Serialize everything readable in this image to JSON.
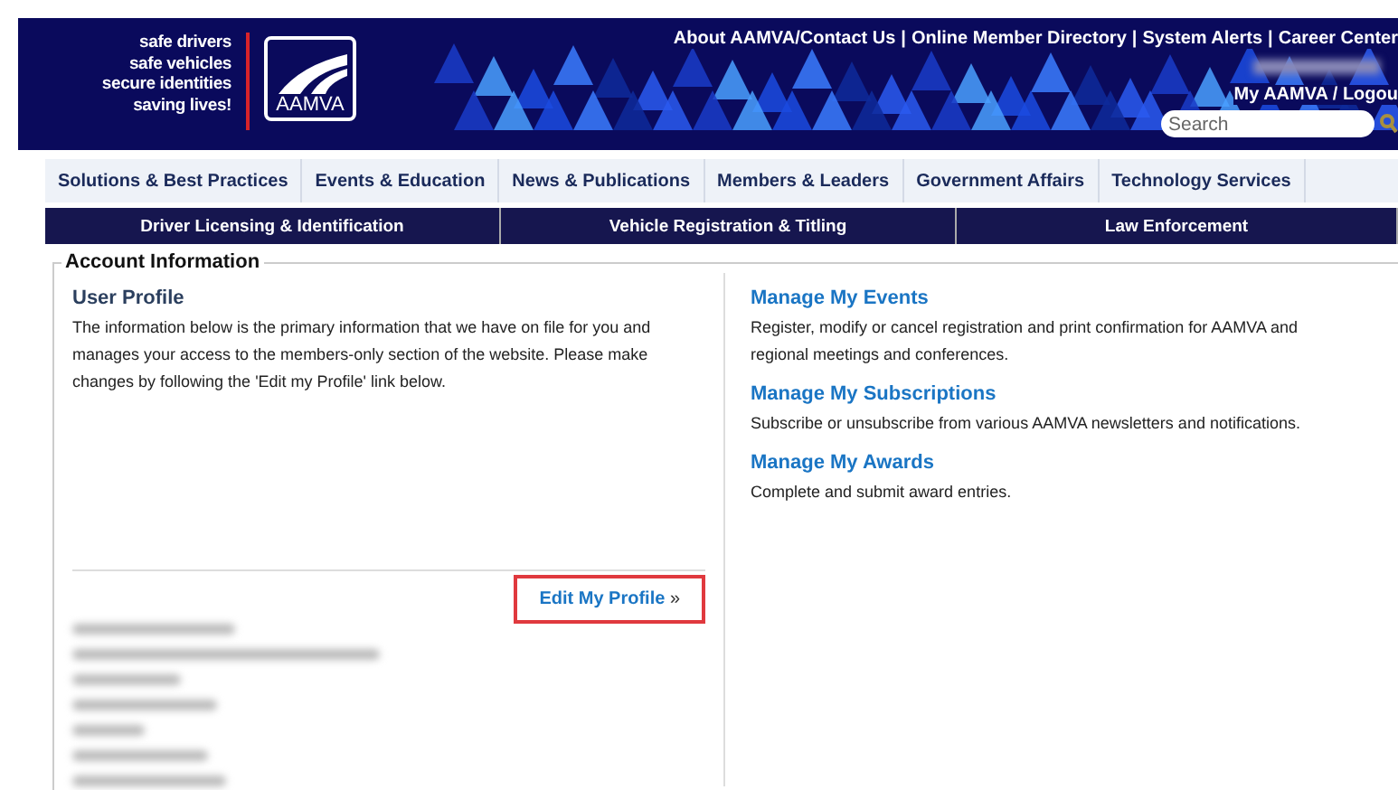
{
  "header": {
    "tagline": [
      "safe drivers",
      "safe vehicles",
      "secure identities",
      "saving lives!"
    ],
    "logo_text": "AAMVA",
    "top_links": [
      "About AAMVA/Contact Us",
      "Online Member Directory",
      "System Alerts",
      "Career Center"
    ],
    "separator": "|",
    "account_links": "My AAMVA / Logou",
    "search": {
      "placeholder": "Search"
    }
  },
  "main_nav": [
    "Solutions & Best Practices",
    "Events & Education",
    "News & Publications",
    "Members & Leaders",
    "Government Affairs",
    "Technology Services"
  ],
  "sub_nav": [
    "Driver Licensing & Identification",
    "Vehicle Registration & Titling",
    "Law Enforcement"
  ],
  "account": {
    "legend": "Account Information",
    "profile": {
      "title": "User Profile",
      "text": "The information below is the primary information that we have on file for you and manages your access to the members-only section of the website. Please make changes by following the 'Edit my Profile' link below.",
      "edit_link": "Edit My Profile",
      "edit_arrow": "»",
      "highlighted": true
    },
    "sections": [
      {
        "title": "Manage My Events",
        "text": "Register, modify or cancel registration and print confirmation for AAMVA and regional meetings and conferences."
      },
      {
        "title": "Manage My Subscriptions",
        "text": "Subscribe or unsubscribe from various AAMVA newsletters and notifications."
      },
      {
        "title": "Manage My Awards",
        "text": "Complete and submit award entries."
      }
    ]
  }
}
